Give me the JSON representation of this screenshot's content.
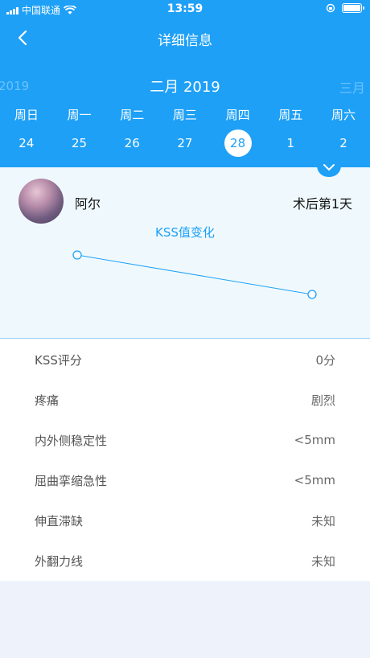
{
  "status": {
    "carrier": "中国联通",
    "time": "13:59"
  },
  "nav": {
    "title": "详细信息"
  },
  "calendar": {
    "prev_month": "2019",
    "current_month": "二月 2019",
    "next_month": "三月",
    "weekdays": [
      "周日",
      "周一",
      "周二",
      "周三",
      "周四",
      "周五",
      "周六"
    ],
    "dates": [
      "24",
      "25",
      "26",
      "27",
      "28",
      "1",
      "2"
    ],
    "selected": "28"
  },
  "patient": {
    "name": "阿尔",
    "postop": "术后第1天"
  },
  "chart_data": {
    "type": "line",
    "title": "KSS值变化",
    "series": [
      {
        "values": [
          "high",
          "low"
        ],
        "color": "#1ea0f7"
      }
    ]
  },
  "details": [
    {
      "label": "KSS评分",
      "value": "0分"
    },
    {
      "label": "疼痛",
      "value": "剧烈"
    },
    {
      "label": "内外侧稳定性",
      "value": "<5mm"
    },
    {
      "label": "屈曲挛缩急性",
      "value": "<5mm"
    },
    {
      "label": "伸直滞缺",
      "value": "未知"
    },
    {
      "label": "外翻力线",
      "value": "未知"
    }
  ],
  "colors": {
    "primary": "#1ea0f7",
    "card_bg": "#eff9fd",
    "page_bg": "#eef3fb"
  }
}
